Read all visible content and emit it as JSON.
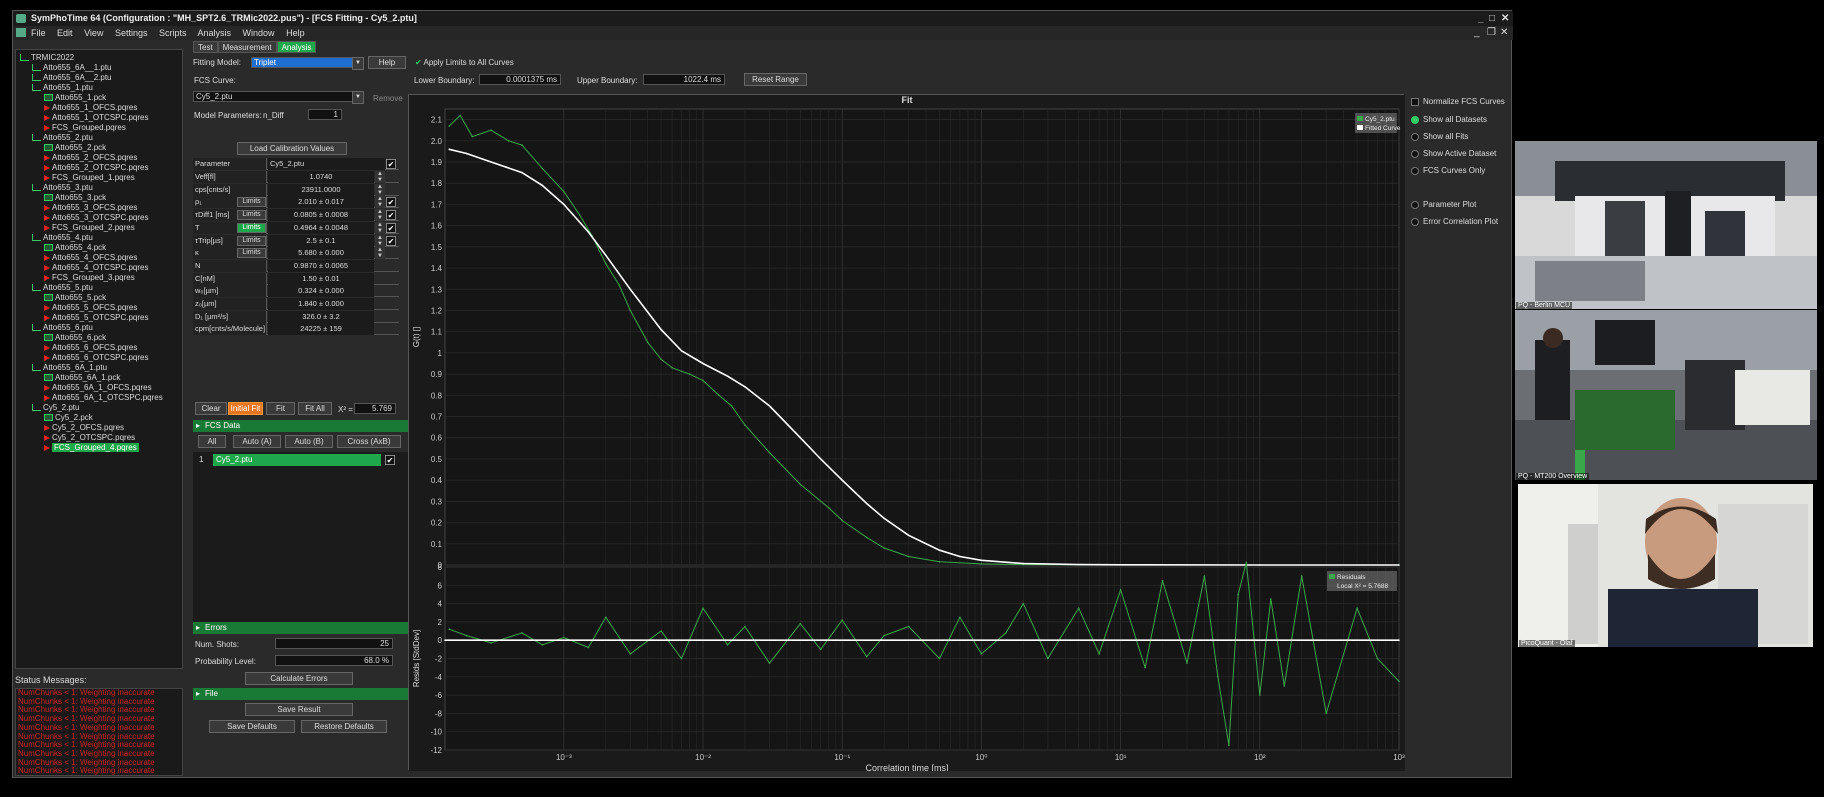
{
  "window": {
    "title": "SymPhoTime 64   (Configuration : \"MH_SPT2.6_TRMic2022.pus\") - [FCS Fitting - Cy5_2.ptu]",
    "controls_outer": [
      "_",
      "□",
      "✕"
    ],
    "controls_inner": [
      "_",
      "❐",
      "✕"
    ]
  },
  "menu": [
    "File",
    "Edit",
    "View",
    "Settings",
    "Scripts",
    "Analysis",
    "Window",
    "Help"
  ],
  "tabs": [
    "Test",
    "Measurement",
    "Analysis"
  ],
  "active_tab": "Analysis",
  "tree": [
    {
      "label": "TRMIC2022",
      "type": "root",
      "indent": 0
    },
    {
      "label": "Atto655_6A__1.ptu",
      "type": "ptu",
      "indent": 1
    },
    {
      "label": "Atto655_6A__2.ptu",
      "type": "ptu",
      "indent": 1
    },
    {
      "label": "Atto655_1.ptu",
      "type": "ptu",
      "indent": 1
    },
    {
      "label": "Atto655_1.pck",
      "type": "pck",
      "indent": 2
    },
    {
      "label": "Atto655_1_OFCS.pqres",
      "type": "pq",
      "indent": 2
    },
    {
      "label": "Atto655_1_OTCSPC.pqres",
      "type": "pq",
      "indent": 2
    },
    {
      "label": "FCS_Grouped.pqres",
      "type": "pq",
      "indent": 2
    },
    {
      "label": "Atto655_2.ptu",
      "type": "ptu",
      "indent": 1
    },
    {
      "label": "Atto655_2.pck",
      "type": "pck",
      "indent": 2
    },
    {
      "label": "Atto655_2_OFCS.pqres",
      "type": "pq",
      "indent": 2
    },
    {
      "label": "Atto655_2_OTCSPC.pqres",
      "type": "pq",
      "indent": 2
    },
    {
      "label": "FCS_Grouped_1.pqres",
      "type": "pq",
      "indent": 2
    },
    {
      "label": "Atto655_3.ptu",
      "type": "ptu",
      "indent": 1
    },
    {
      "label": "Atto655_3.pck",
      "type": "pck",
      "indent": 2
    },
    {
      "label": "Atto655_3_OFCS.pqres",
      "type": "pq",
      "indent": 2
    },
    {
      "label": "Atto655_3_OTCSPC.pqres",
      "type": "pq",
      "indent": 2
    },
    {
      "label": "FCS_Grouped_2.pqres",
      "type": "pq",
      "indent": 2
    },
    {
      "label": "Atto655_4.ptu",
      "type": "ptu",
      "indent": 1
    },
    {
      "label": "Atto655_4.pck",
      "type": "pck",
      "indent": 2
    },
    {
      "label": "Atto655_4_OFCS.pqres",
      "type": "pq",
      "indent": 2
    },
    {
      "label": "Atto655_4_OTCSPC.pqres",
      "type": "pq",
      "indent": 2
    },
    {
      "label": "FCS_Grouped_3.pqres",
      "type": "pq",
      "indent": 2
    },
    {
      "label": "Atto655_5.ptu",
      "type": "ptu",
      "indent": 1
    },
    {
      "label": "Atto655_5.pck",
      "type": "pck",
      "indent": 2
    },
    {
      "label": "Atto655_5_OFCS.pqres",
      "type": "pq",
      "indent": 2
    },
    {
      "label": "Atto655_5_OTCSPC.pqres",
      "type": "pq",
      "indent": 2
    },
    {
      "label": "Atto655_6.ptu",
      "type": "ptu",
      "indent": 1
    },
    {
      "label": "Atto655_6.pck",
      "type": "pck",
      "indent": 2
    },
    {
      "label": "Atto655_6_OFCS.pqres",
      "type": "pq",
      "indent": 2
    },
    {
      "label": "Atto655_6_OTCSPC.pqres",
      "type": "pq",
      "indent": 2
    },
    {
      "label": "Atto655_6A_1.ptu",
      "type": "ptu",
      "indent": 1
    },
    {
      "label": "Atto655_6A_1.pck",
      "type": "pck",
      "indent": 2
    },
    {
      "label": "Atto655_6A_1_OFCS.pqres",
      "type": "pq",
      "indent": 2
    },
    {
      "label": "Atto655_6A_1_OTCSPC.pqres",
      "type": "pq",
      "indent": 2
    },
    {
      "label": "Cy5_2.ptu",
      "type": "ptu",
      "indent": 1
    },
    {
      "label": "Cy5_2.pck",
      "type": "pck",
      "indent": 2
    },
    {
      "label": "Cy5_2_OFCS.pqres",
      "type": "pq",
      "indent": 2
    },
    {
      "label": "Cy5_2_OTCSPC.pqres",
      "type": "pq",
      "indent": 2
    },
    {
      "label": "FCS_Grouped_4.pqres",
      "type": "pq",
      "indent": 2,
      "selected": true
    }
  ],
  "status": {
    "heading": "Status Messages:",
    "messages": [
      "NumChunks < 1: Weighting inaccurate",
      "NumChunks < 1: Weighting inaccurate",
      "NumChunks < 1: Weighting inaccurate",
      "NumChunks < 1: Weighting inaccurate",
      "NumChunks < 1: Weighting inaccurate",
      "NumChunks < 1: Weighting inaccurate",
      "NumChunks < 1: Weighting inaccurate",
      "NumChunks < 1: Weighting inaccurate",
      "NumChunks < 1: Weighting inaccurate",
      "NumChunks < 1: Weighting inaccurate"
    ]
  },
  "fitting": {
    "model_label": "Fitting Model:",
    "model_value": "Triplet",
    "help": "Help",
    "apply_limits": "Apply Limits to All Curves",
    "lower_label": "Lower Boundary:",
    "lower_value": "0.0001375 ms",
    "upper_label": "Upper Boundary:",
    "upper_value": "1022.4 ms",
    "reset_range": "Reset Range",
    "fcs_curve_label": "FCS Curve:",
    "fcs_curve_value": "Cy5_2.ptu",
    "remove": "Remove",
    "model_params_label": "Model Parameters:",
    "ndiff_label": "n_Diff",
    "ndiff_value": "1",
    "load_calib": "Load Calibration Values"
  },
  "param_table": {
    "header_param": "Parameter",
    "header_value": "Cy5_2.ptu",
    "limits_label": "Limits",
    "rows": [
      {
        "name": "Veff[fl]",
        "value": "1.0740",
        "limits": false,
        "spin": true,
        "check": false
      },
      {
        "name": "cps[cnts/s]",
        "value": "23911.0000",
        "limits": false,
        "spin": true,
        "check": false
      },
      {
        "name": "ρ₁",
        "value": "2.010 ± 0.017",
        "limits": true,
        "lim_on": false,
        "spin": true,
        "check": true
      },
      {
        "name": "τDiff1 [ms]",
        "value": "0.0805 ± 0.0008",
        "limits": true,
        "lim_on": false,
        "spin": true,
        "check": true
      },
      {
        "name": "T",
        "value": "0.4964 ± 0.0048",
        "limits": true,
        "lim_on": true,
        "spin": true,
        "check": true
      },
      {
        "name": "τTrip[µs]",
        "value": "2.5 ± 0.1",
        "limits": true,
        "lim_on": false,
        "spin": true,
        "check": true
      },
      {
        "name": "κ",
        "value": "5.680 ± 0.000",
        "limits": true,
        "lim_on": false,
        "spin": true,
        "check": false
      },
      {
        "name": "N",
        "value": "0.9870 ± 0.0065",
        "limits": false,
        "spin": false,
        "check": false
      },
      {
        "name": "C[nM]",
        "value": "1.50 ± 0.01",
        "limits": false,
        "spin": false,
        "check": false
      },
      {
        "name": "w₀[µm]",
        "value": "0.324 ± 0.000",
        "limits": false,
        "spin": false,
        "check": false
      },
      {
        "name": "z₀[µm]",
        "value": "1.840 ± 0.000",
        "limits": false,
        "spin": false,
        "check": false
      },
      {
        "name": "D₁ [µm²/s]",
        "value": "326.0 ± 3.2",
        "limits": false,
        "spin": false,
        "check": false
      },
      {
        "name": "cpm[cnts/s/Molecule]",
        "value": "24225 ± 159",
        "limits": false,
        "spin": false,
        "check": false
      }
    ]
  },
  "fit_buttons": {
    "clear": "Clear",
    "initial_fit": "Initial Fit",
    "fit": "Fit",
    "fit_all": "Fit All",
    "chi_label": "X² =",
    "chi_value": "5.769"
  },
  "fcs_data": {
    "heading": "FCS Data",
    "buttons": [
      "All",
      "Auto (A)",
      "Auto (B)",
      "Cross (AxB)"
    ],
    "rows": [
      {
        "index": "1",
        "name": "Cy5_2.ptu"
      }
    ]
  },
  "errors": {
    "heading": "Errors",
    "shots_label": "Num. Shots:",
    "shots_value": "25",
    "prob_label": "Probability Level:",
    "prob_value": "68.0 %",
    "calc": "Calculate Errors"
  },
  "file": {
    "heading": "File",
    "save_result": "Save Result",
    "save_defaults": "Save Defaults",
    "restore_defaults": "Restore Defaults"
  },
  "right_options": [
    {
      "label": "Normalize FCS Curves",
      "on": false,
      "sq": true
    },
    {
      "label": "Show all Datasets",
      "on": true,
      "sq": false
    },
    {
      "label": "Show all Fits",
      "on": false,
      "sq": false
    },
    {
      "label": "Show Active Dataset",
      "on": false,
      "sq": false
    },
    {
      "label": "FCS Curves Only",
      "on": false,
      "sq": false
    },
    {
      "label": "Parameter Plot",
      "on": false,
      "sq": false
    },
    {
      "label": "Error Correlation Plot",
      "on": false,
      "sq": false
    }
  ],
  "chart_data": [
    {
      "type": "line",
      "title": "Fit",
      "xlabel": "Correlation time [ms]",
      "ylabel": "G(t) []",
      "xscale": "log",
      "xlim": [
        0.00014,
        1000
      ],
      "ylim": [
        0,
        2.15
      ],
      "x_tick_labels": [
        "10⁻³",
        "10⁻²",
        "10⁻¹",
        "10⁰",
        "10¹",
        "10²",
        "10³"
      ],
      "y_ticks": [
        0,
        0.1,
        0.2,
        0.3,
        0.4,
        0.5,
        0.6,
        0.7,
        0.8,
        0.9,
        1.0,
        1.1,
        1.2,
        1.3,
        1.4,
        1.5,
        1.6,
        1.7,
        1.8,
        1.9,
        2.0,
        2.1
      ],
      "y_tick_labels": [
        "0",
        "0.1",
        "0.2",
        "0.3",
        "0.4",
        "0.5",
        "0.6",
        "0.7",
        "0.8",
        "0.9",
        "1",
        "1.1",
        "1.2",
        "1.3",
        "1.4",
        "1.5",
        "1.6",
        "1.7",
        "1.8",
        "1.9",
        "2.0",
        "2.1"
      ],
      "legend": [
        "Cy5_2.ptu",
        "Fitted Curve"
      ],
      "legend_position": "top-right",
      "series": [
        {
          "name": "Cy5_2.ptu",
          "color": "#3aa84a",
          "x": [
            0.00015,
            0.00018,
            0.00022,
            0.0003,
            0.0004,
            0.0005,
            0.0007,
            0.001,
            0.0013,
            0.0016,
            0.002,
            0.0025,
            0.003,
            0.004,
            0.005,
            0.006,
            0.008,
            0.01,
            0.013,
            0.016,
            0.02,
            0.03,
            0.05,
            0.08,
            0.1,
            0.15,
            0.2,
            0.3,
            0.5,
            1,
            2,
            5,
            10,
            30,
            100,
            1000
          ],
          "y": [
            2.07,
            2.12,
            2.02,
            2.05,
            2.0,
            1.98,
            1.87,
            1.76,
            1.65,
            1.55,
            1.42,
            1.32,
            1.2,
            1.05,
            0.97,
            0.93,
            0.9,
            0.87,
            0.8,
            0.75,
            0.66,
            0.53,
            0.38,
            0.27,
            0.21,
            0.13,
            0.08,
            0.04,
            0.015,
            0.005,
            0.002,
            0.001,
            0.001,
            0,
            0,
            0
          ]
        },
        {
          "name": "Fitted Curve",
          "color": "#ffffff",
          "x": [
            0.00015,
            0.0002,
            0.0003,
            0.0005,
            0.0007,
            0.001,
            0.0015,
            0.002,
            0.003,
            0.005,
            0.007,
            0.01,
            0.015,
            0.02,
            0.03,
            0.05,
            0.07,
            0.1,
            0.15,
            0.2,
            0.3,
            0.5,
            0.7,
            1,
            2,
            5,
            10,
            100,
            1000
          ],
          "y": [
            1.96,
            1.94,
            1.9,
            1.85,
            1.79,
            1.7,
            1.57,
            1.46,
            1.3,
            1.11,
            1.01,
            0.95,
            0.89,
            0.84,
            0.75,
            0.6,
            0.5,
            0.4,
            0.29,
            0.22,
            0.14,
            0.07,
            0.04,
            0.022,
            0.007,
            0.002,
            0.001,
            0,
            0
          ]
        }
      ]
    },
    {
      "type": "line",
      "title": "",
      "xlabel": "Correlation time [ms]",
      "ylabel": "Resids [StdDev]",
      "xscale": "log",
      "xlim": [
        0.00014,
        1000
      ],
      "ylim": [
        -12,
        8
      ],
      "y_tick_labels": [
        "8",
        "6",
        "4",
        "2",
        "0",
        "-2",
        "-4",
        "-6",
        "-8",
        "-10",
        "-12"
      ],
      "y_ticks": [
        8,
        6,
        4,
        2,
        0,
        -2,
        -4,
        -6,
        -8,
        -10,
        -12
      ],
      "legend": [
        "Residuals",
        "Local X² = 5.7688"
      ],
      "legend_position": "top-right",
      "series": [
        {
          "name": "Residuals",
          "color": "#3aa84a",
          "x": [
            0.00015,
            0.0002,
            0.0003,
            0.0005,
            0.0007,
            0.001,
            0.0015,
            0.002,
            0.003,
            0.005,
            0.007,
            0.01,
            0.015,
            0.02,
            0.03,
            0.05,
            0.07,
            0.1,
            0.15,
            0.2,
            0.3,
            0.5,
            0.7,
            1,
            1.5,
            2,
            3,
            5,
            7,
            10,
            15,
            20,
            30,
            40,
            50,
            60,
            70,
            80,
            100,
            120,
            150,
            200,
            300,
            500,
            700,
            1000
          ],
          "y": [
            1.2,
            0.5,
            -0.3,
            0.8,
            -0.5,
            0.3,
            -0.8,
            2.5,
            -1.5,
            1.0,
            -2.0,
            3.5,
            -0.5,
            1.5,
            -2.5,
            1.8,
            -1.0,
            2.2,
            -1.8,
            0.5,
            1.5,
            -2.0,
            2.5,
            -1.5,
            0.8,
            4.0,
            -2.0,
            3.5,
            -1.5,
            5.5,
            -3.0,
            6.5,
            -2.5,
            7.0,
            -4.0,
            -11.5,
            5.0,
            8.5,
            -6.0,
            4.5,
            -5.0,
            7.0,
            -8.0,
            3.5,
            -2.0,
            -4.5
          ]
        },
        {
          "name": "Zero line",
          "color": "#ffffff",
          "x": [
            0.00014,
            1000
          ],
          "y": [
            0,
            0
          ]
        }
      ]
    }
  ],
  "video": {
    "labels": [
      "PQ - Berlin MCU",
      "PQ - MT200 Overview",
      "PicoQuant - Olaf"
    ]
  }
}
